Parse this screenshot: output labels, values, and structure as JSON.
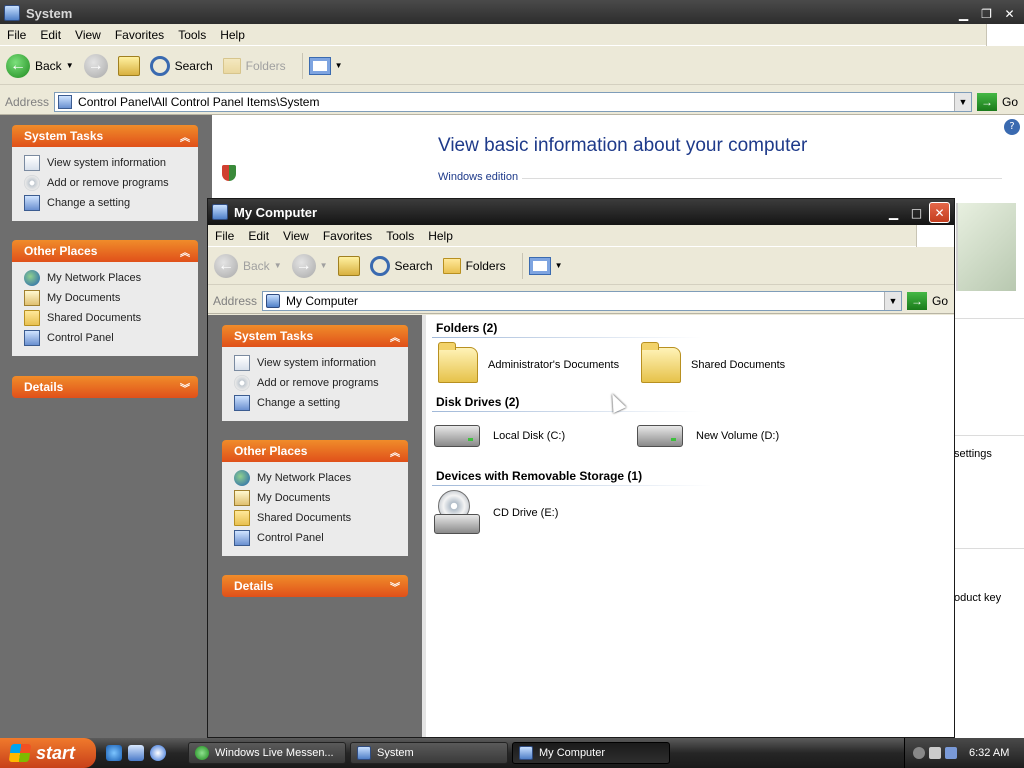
{
  "back_window": {
    "title": "System",
    "menu": [
      "File",
      "Edit",
      "View",
      "Favorites",
      "Tools",
      "Help"
    ],
    "toolbar": {
      "back": "Back",
      "search": "Search",
      "folders": "Folders"
    },
    "address": {
      "label": "Address",
      "value": "Control Panel\\All Control Panel Items\\System",
      "go": "Go"
    },
    "system_tasks": {
      "title": "System Tasks",
      "items": [
        "View system information",
        "Add or remove programs",
        "Change a setting"
      ]
    },
    "other_places": {
      "title": "Other Places",
      "items": [
        "My Network Places",
        "My Documents",
        "Shared Documents",
        "Control Panel"
      ]
    },
    "details": {
      "title": "Details"
    },
    "content": {
      "heading": "View basic information about your computer",
      "section": "Windows edition",
      "partial_text_1": "settings",
      "partial_text_2": "oduct key"
    }
  },
  "front_window": {
    "title": "My Computer",
    "menu": [
      "File",
      "Edit",
      "View",
      "Favorites",
      "Tools",
      "Help"
    ],
    "toolbar": {
      "back": "Back",
      "search": "Search",
      "folders": "Folders"
    },
    "address": {
      "label": "Address",
      "value": "My Computer",
      "go": "Go"
    },
    "system_tasks": {
      "title": "System Tasks",
      "items": [
        "View system information",
        "Add or remove programs",
        "Change a setting"
      ]
    },
    "other_places": {
      "title": "Other Places",
      "items": [
        "My Network Places",
        "My Documents",
        "Shared Documents",
        "Control Panel"
      ]
    },
    "details": {
      "title": "Details"
    },
    "groups": {
      "folders": {
        "title": "Folders (2)",
        "items": [
          "Administrator's Documents",
          "Shared Documents"
        ]
      },
      "drives": {
        "title": "Disk Drives (2)",
        "items": [
          "Local Disk (C:)",
          "New Volume (D:)"
        ]
      },
      "removable": {
        "title": "Devices with Removable Storage (1)",
        "items": [
          "CD Drive (E:)"
        ]
      }
    }
  },
  "taskbar": {
    "start": "start",
    "tasks": [
      "Windows Live Messen...",
      "System",
      "My Computer"
    ],
    "clock": "6:32 AM"
  }
}
